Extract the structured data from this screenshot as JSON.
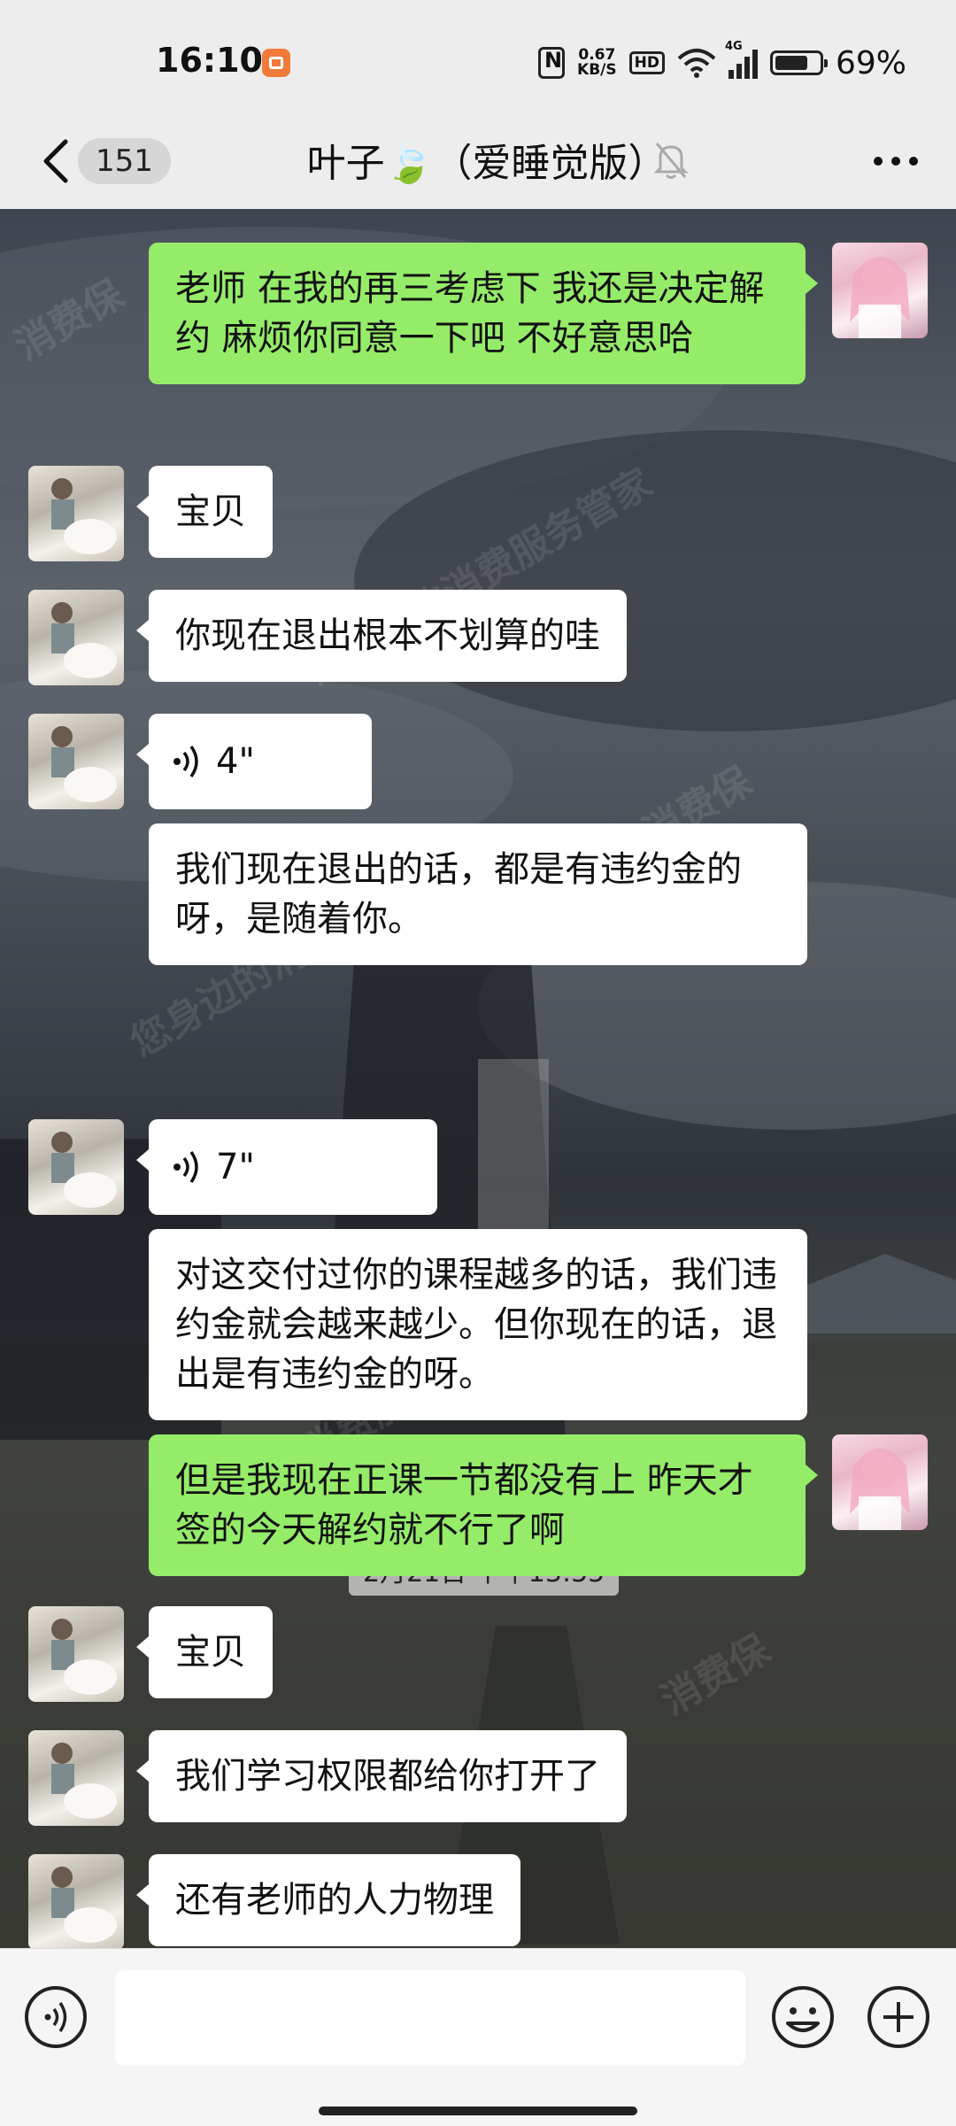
{
  "status_bar": {
    "time": "16:10",
    "net_speed_value": "0.67",
    "net_speed_unit": "KB/S",
    "hd": "HD",
    "signal_label": "4G",
    "battery": "69%"
  },
  "nav": {
    "unread_count": "151",
    "title_prefix": "叶子",
    "title_emoji": "🍃",
    "title_suffix": "（爱睡觉版）",
    "back_icon": "chevron-left-icon",
    "mute_icon": "bell-off-icon",
    "more_icon": "more-dots-icon"
  },
  "messages": [
    {
      "side": "out",
      "type": "text",
      "text": "老师 在我的再三考虑下 我还是决定解约 麻烦你同意一下吧 不好意思哈"
    },
    {
      "side": "in",
      "type": "text",
      "text": "宝贝"
    },
    {
      "side": "in",
      "type": "text",
      "text": "你现在退出根本不划算的哇"
    },
    {
      "side": "in",
      "type": "voice",
      "duration": "4\""
    },
    {
      "side": "in",
      "type": "text",
      "text": "我们现在退出的话，都是有违约金的呀，是随着你。"
    },
    {
      "side": "in",
      "type": "voice",
      "duration": "7\""
    },
    {
      "side": "in",
      "type": "text",
      "text": "对这交付过你的课程越多的话，我们违约金就会越来越少。但你现在的话，退出是有违约金的呀。"
    },
    {
      "side": "out",
      "type": "text",
      "text": "但是我现在正课一节都没有上 昨天才签的今天解约就不行了啊"
    },
    {
      "side": "in",
      "type": "text",
      "text": "宝贝"
    },
    {
      "side": "in",
      "type": "text",
      "text": "我们学习权限都给你打开了"
    },
    {
      "side": "in",
      "type": "text",
      "text": "还有老师的人力物理"
    }
  ],
  "timestamp": "2月21日 下午13:55",
  "watermarks": [
    "消费保",
    "您身边的消费服务管家"
  ],
  "input_bar": {
    "voice_icon": "voice-mode-icon",
    "emoji_icon": "emoji-icon",
    "plus_icon": "plus-icon"
  },
  "colors": {
    "background": "#ededed",
    "outgoing_bubble": "#95ec69",
    "incoming_bubble": "#ffffff"
  }
}
